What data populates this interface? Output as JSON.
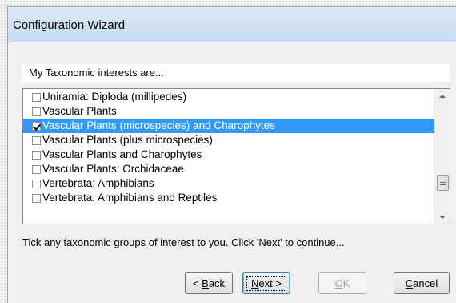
{
  "window": {
    "title": "Configuration Wizard"
  },
  "prompt": "My Taxonomic interests are...",
  "list": {
    "items": [
      {
        "label": "Uniramia: Diploda (millipedes)",
        "checked": false,
        "selected": false
      },
      {
        "label": "Vascular Plants",
        "checked": false,
        "selected": false
      },
      {
        "label": "Vascular Plants (microspecies) and Charophytes",
        "checked": true,
        "selected": true
      },
      {
        "label": "Vascular Plants (plus microspecies)",
        "checked": false,
        "selected": false
      },
      {
        "label": "Vascular Plants and Charophytes",
        "checked": false,
        "selected": false
      },
      {
        "label": "Vascular Plants: Orchidaceae",
        "checked": false,
        "selected": false
      },
      {
        "label": "Vertebrata: Amphibians",
        "checked": false,
        "selected": false
      },
      {
        "label": "Vertebrata: Amphibians and Reptiles",
        "checked": false,
        "selected": false
      }
    ]
  },
  "instruction": "Tick any taxonomic groups of interest to you.  Click 'Next' to continue...",
  "buttons": {
    "back": {
      "arrow": "<",
      "mnemonic": "B",
      "rest": "ack"
    },
    "next": {
      "mnemonic": "N",
      "rest": "ext",
      "arrow": ">"
    },
    "ok": {
      "mnemonic": "O",
      "rest": "K"
    },
    "cancel": {
      "mnemonic": "C",
      "rest": "ancel"
    }
  },
  "colors": {
    "selection": "#3399ff",
    "titlebar": "#c9dcf1"
  }
}
